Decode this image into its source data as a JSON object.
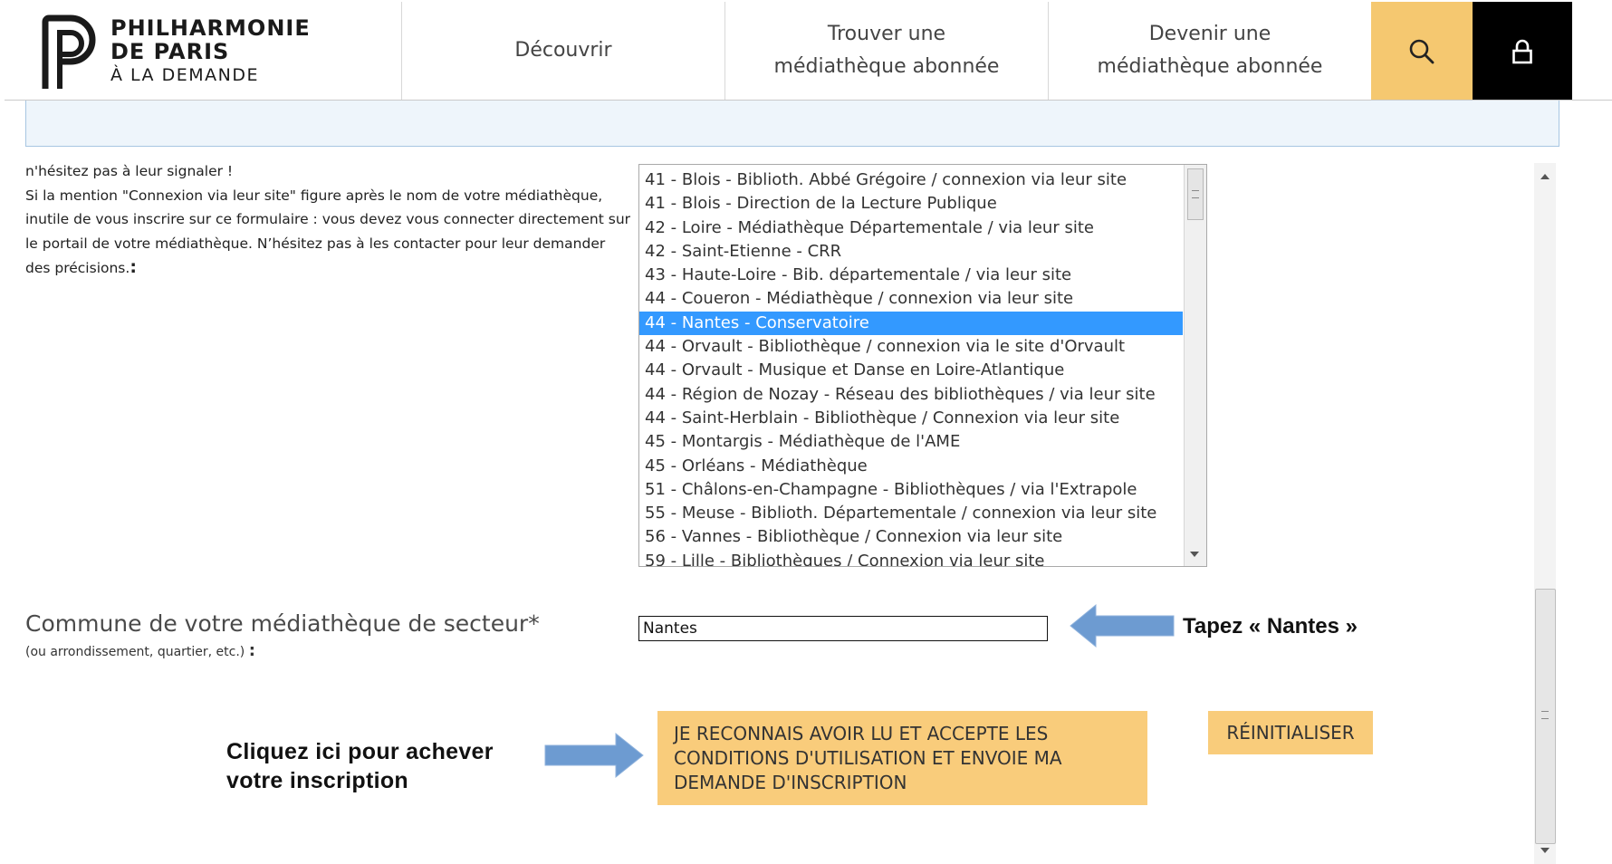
{
  "header": {
    "logo": {
      "line1": "PHILHARMONIE",
      "line2": "DE PARIS",
      "line3": "À LA DEMANDE"
    },
    "nav": [
      {
        "line1": "Découvrir",
        "line2": ""
      },
      {
        "line1": "Trouver une",
        "line2": "médiathèque abonnée"
      },
      {
        "line1": "Devenir une",
        "line2": "médiathèque abonnée"
      }
    ],
    "search_icon": "search-icon",
    "lock_icon": "lock-icon",
    "colors": {
      "search_bg": "#f5c870",
      "lock_bg": "#000000"
    }
  },
  "intro": {
    "line1": "n'hésitez pas à leur signaler !",
    "paragraph": "Si la mention \"Connexion via leur site\" figure après le nom de votre médiathèque, inutile de vous inscrire sur ce formulaire : vous devez vous connecter directement sur le portail de votre médiathèque. N’hésitez pas à les contacter pour leur demander des précisions.",
    "colon": ":"
  },
  "library_list": {
    "options": [
      "41 - Blois - Biblioth. Abbé Grégoire / connexion via leur site",
      "41 - Blois - Direction de la Lecture Publique",
      "42 - Loire - Médiathèque Départementale / via leur site",
      "42 - Saint-Etienne - CRR",
      "43 - Haute-Loire - Bib. départementale / via leur site",
      "44 - Coueron - Médiathèque / connexion via leur site",
      "44 - Nantes - Conservatoire",
      "44 - Orvault - Bibliothèque / connexion via le site d'Orvault",
      "44 - Orvault - Musique et Danse en Loire-Atlantique",
      "44 - Région de Nozay - Réseau des bibliothèques / via leur site",
      "44 - Saint-Herblain - Bibliothèque / Connexion via leur site",
      "45 - Montargis - Médiathèque de l'AME",
      "45 - Orléans - Médiathèque",
      "51 - Châlons-en-Champagne - Bibliothèques / via l'Extrapole",
      "55 - Meuse - Biblioth. Départementale / connexion via leur site",
      "56 - Vannes - Bibliothèque / Connexion via leur site",
      "59 - Lille - Bibliothèques / Connexion via leur site"
    ],
    "selected": "44 - Nantes - Conservatoire",
    "selected_color": "#3399ff"
  },
  "commune": {
    "label": "Commune de votre médiathèque de secteur*",
    "sub": "(ou arrondissement, quartier, etc.)",
    "colon": ":",
    "value": "Nantes",
    "hint": "Tapez « Nantes »"
  },
  "actions": {
    "hint_line1": "Cliquez ici pour achever",
    "hint_line2": "votre inscription",
    "accept_line1": "JE RECONNAIS AVOIR LU ET ACCEPTE LES",
    "accept_line2": "CONDITIONS D'UTILISATION ET ENVOIE MA",
    "accept_line3": "DEMANDE D'INSCRIPTION",
    "reset_label": "RÉINITIALISER",
    "button_color": "#f9cc7b",
    "arrow_color": "#6d9bd1"
  }
}
